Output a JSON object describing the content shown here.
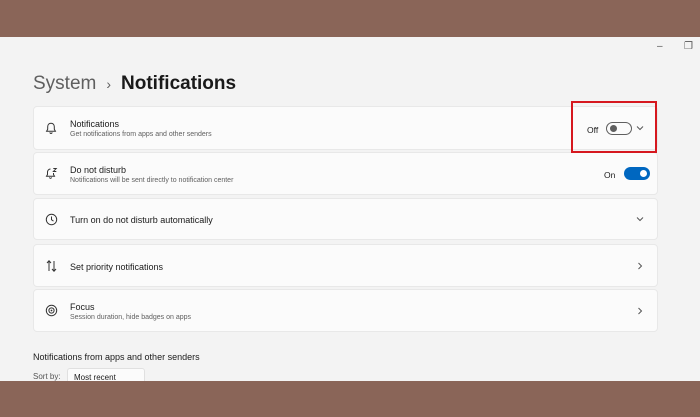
{
  "breadcrumb": {
    "parent": "System",
    "separator": "›",
    "current": "Notifications"
  },
  "cards": [
    {
      "title": "Notifications",
      "subtitle": "Get notifications from apps and other senders",
      "toggle_label": "Off",
      "toggle_state": "off",
      "icon": "bell-icon",
      "chevron": "chevron-down-icon"
    },
    {
      "title": "Do not disturb",
      "subtitle": "Notifications will be sent directly to notification center",
      "toggle_label": "On",
      "toggle_state": "on",
      "icon": "bell-snooze-icon"
    },
    {
      "title": "Turn on do not disturb automatically",
      "icon": "clock-icon",
      "chevron": "chevron-down-icon"
    },
    {
      "title": "Set priority notifications",
      "icon": "priority-arrows-icon",
      "chevron": "chevron-right-icon"
    },
    {
      "title": "Focus",
      "subtitle": "Session duration, hide badges on apps",
      "icon": "focus-icon",
      "chevron": "chevron-right-icon"
    }
  ],
  "section": {
    "title": "Notifications from apps and other senders"
  },
  "sort": {
    "label": "Sort by:",
    "value": "Most recent"
  },
  "colors": {
    "accent": "#0067c0",
    "highlight": "#d6181f",
    "backdrop": "#8a6558"
  }
}
